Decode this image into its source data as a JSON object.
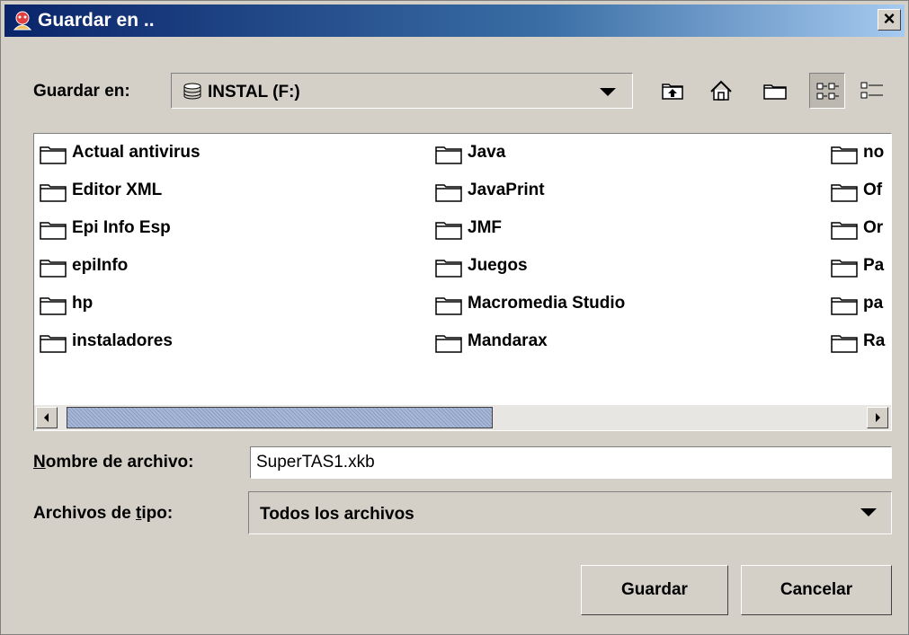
{
  "window": {
    "title": "Guardar en .."
  },
  "toolbar": {
    "save_in_label": "Guardar en:",
    "location": "INSTAL (F:)",
    "buttons": [
      "up-one-level",
      "home",
      "new-folder",
      "list-view",
      "details-view"
    ]
  },
  "files": [
    [
      "Actual antivirus",
      "Editor XML",
      "Epi Info Esp",
      "epiInfo",
      "hp",
      "instaladores"
    ],
    [
      "Java",
      "JavaPrint",
      "JMF",
      "Juegos",
      "Macromedia Studio",
      "Mandarax"
    ],
    [
      "no",
      "Of",
      "Or",
      "Pa",
      "pa",
      "Ra"
    ]
  ],
  "filename": {
    "label_underlined": "N",
    "label_rest": "ombre de archivo:",
    "value": "SuperTAS1.xkb"
  },
  "filetype": {
    "label_before": "Archivos de ",
    "label_underlined": "t",
    "label_after": "ipo:",
    "value": "Todos los archivos"
  },
  "buttons": {
    "save": "Guardar",
    "cancel": "Cancelar"
  },
  "colors": {
    "titlebar_start": "#0a246a",
    "titlebar_end": "#a6caf0",
    "face": "#d4d0c8"
  }
}
